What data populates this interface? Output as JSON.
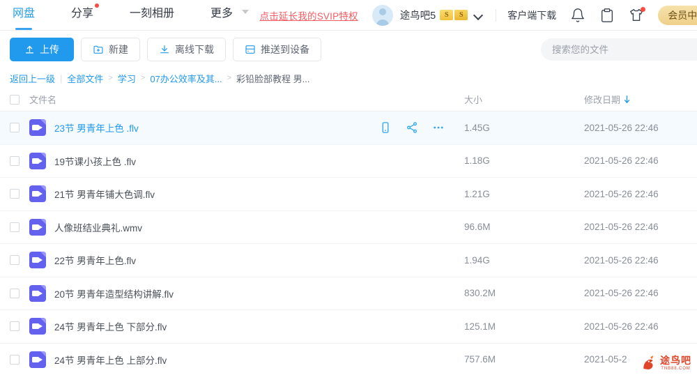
{
  "nav": {
    "tabs": [
      {
        "label": "网盘",
        "active": true,
        "dot": false
      },
      {
        "label": "分享",
        "active": false,
        "dot": true
      },
      {
        "label": "一刻相册",
        "active": false,
        "dot": false
      },
      {
        "label": "更多",
        "active": false,
        "dot": false,
        "caret": true
      }
    ],
    "svip_link": "点击延长我的SVIP特权",
    "username": "途鸟吧5",
    "badge_1": "S",
    "badge_2": "S",
    "client_download": "客户端下载",
    "vip_button": "会员中心",
    "icons": {
      "avatar": "avatar-icon",
      "chevron": "chevron-down-icon",
      "bell": "bell-icon",
      "clipboard": "clipboard-icon",
      "tshirt": "tshirt-icon"
    },
    "accent": "#2199ed",
    "vip_color": "#eed08a",
    "link_color": "#f35d63"
  },
  "toolbar": {
    "upload": "上传",
    "new": "新建",
    "offline_download": "离线下载",
    "push_to_device": "推送到设备"
  },
  "search": {
    "placeholder": "搜索您的文件",
    "value": ""
  },
  "breadcrumb": {
    "back": "返回上一级",
    "divider": "|",
    "items": [
      "全部文件",
      "学习",
      "07办公效率及其...",
      "彩铅脸部教程 男..."
    ],
    "separator": ">"
  },
  "table": {
    "headers": {
      "name": "文件名",
      "size": "大小",
      "date": "修改日期"
    },
    "sort": "desc",
    "rows": [
      {
        "name": "23节 男青年上色 .flv",
        "size": "1.45G",
        "date": "2021-05-26 22:46",
        "type": "video",
        "hover": true
      },
      {
        "name": "19节课小孩上色 .flv",
        "size": "1.18G",
        "date": "2021-05-26 22:46",
        "type": "video",
        "hover": false
      },
      {
        "name": "21节 男青年铺大色调.flv",
        "size": "1.21G",
        "date": "2021-05-26 22:46",
        "type": "video",
        "hover": false
      },
      {
        "name": "人像班结业典礼.wmv",
        "size": "96.6M",
        "date": "2021-05-26 22:46",
        "type": "video",
        "hover": false
      },
      {
        "name": "22节 男青年上色.flv",
        "size": "1.94G",
        "date": "2021-05-26 22:46",
        "type": "video",
        "hover": false
      },
      {
        "name": "20节 男青年造型结构讲解.flv",
        "size": "830.2M",
        "date": "2021-05-26 22:46",
        "type": "video",
        "hover": false
      },
      {
        "name": "24节 男青年上色 下部分.flv",
        "size": "125.1M",
        "date": "2021-05-26 22:46",
        "type": "video",
        "hover": false
      },
      {
        "name": "24节 男青年上色 上部分.flv",
        "size": "757.6M",
        "date": "2021-05-2",
        "type": "video",
        "hover": false
      }
    ],
    "row_actions": {
      "device": "device-icon",
      "share": "share-icon",
      "more": "more-icon"
    }
  },
  "watermark": {
    "text": "途鸟吧",
    "sub": "TNB88.COM",
    "color": "#e0452a"
  }
}
